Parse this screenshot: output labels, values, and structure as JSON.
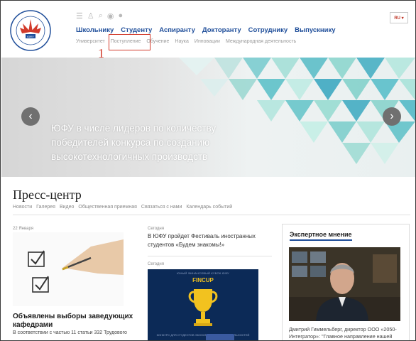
{
  "header": {
    "logo_text": "Южный Федеральный Университет ЮФУ",
    "language": "RU ▾",
    "main_nav": [
      "Школьнику",
      "Студенту",
      "Аспиранту",
      "Докторанту",
      "Сотруднику",
      "Выпускнику"
    ],
    "sub_nav": [
      "Университет",
      "Поступление",
      "Обучение",
      "Наука",
      "Инновации",
      "Международная деятельность"
    ],
    "marker": "1"
  },
  "banner": {
    "text": "ЮФУ в числе лидеров по количеству победителей конкурса по созданию высокотехнологичных производств",
    "prev": "‹",
    "next": "›"
  },
  "press": {
    "title": "Пресс-центр",
    "nav": [
      "Новости",
      "Галерея",
      "Видео",
      "Общественная приемная",
      "Связаться с нами",
      "Календарь событий"
    ],
    "news1": {
      "date": "22 Января",
      "title": "Объявлены выборы заведующих кафедрами",
      "text": "В соответствии с частью 11 статьи 332 Трудового"
    },
    "news2": {
      "date": "Сегодня",
      "title": "В ЮФУ пройдет Фестиваль иностранных студентов «Будем знакомы!»"
    },
    "news3": {
      "date": "Сегодня",
      "fincup_small": "ЮНЫЙ ФИНАНСОВЫЙ КУБОК ЮФУ",
      "fincup_big": "FINCUP",
      "fincup_bottom": "КОНКУРС ДЛЯ СТУДЕНТОВ ЭКОНОМИЧЕСКИХ СПЕЦИАЛЬНОСТЕЙ"
    },
    "expert": {
      "title": "Экспертное мнение",
      "caption": "Дмитрий Гиммельберг, директор ООО «2050-Интегратор»: \"Главное направление нашей"
    }
  },
  "colors": {
    "nav_blue": "#1f4e9a",
    "highlight_red": "#d23a2a",
    "fincup_bg": "#0c2a57",
    "gold": "#f2c21f"
  }
}
